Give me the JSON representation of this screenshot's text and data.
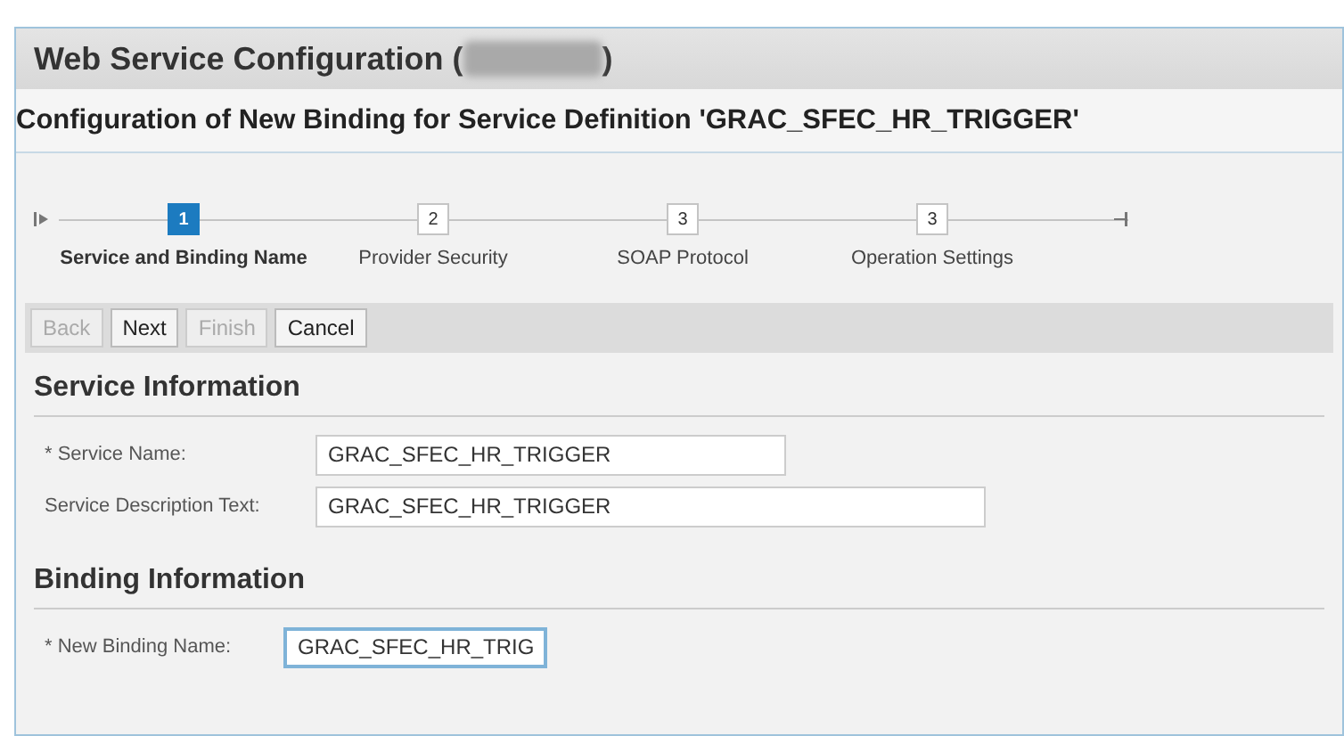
{
  "window": {
    "title_before": "Web Service Configuration (",
    "title_after": ")"
  },
  "subtitle": "Configuration of New Binding for Service Definition 'GRAC_SFEC_HR_TRIGGER'",
  "steps": [
    {
      "number": "1",
      "label": "Service and Binding Name",
      "selected": true
    },
    {
      "number": "2",
      "label": "Provider Security",
      "selected": false
    },
    {
      "number": "3",
      "label": "SOAP Protocol",
      "selected": false
    },
    {
      "number": "3",
      "label": "Operation Settings",
      "selected": false
    }
  ],
  "buttons": [
    {
      "label": "Back",
      "disabled": true
    },
    {
      "label": "Next",
      "disabled": false
    },
    {
      "label": "Finish",
      "disabled": true
    },
    {
      "label": "Cancel",
      "disabled": false
    }
  ],
  "sections": [
    {
      "title": "Service Information",
      "fields": [
        {
          "label": "* Service Name:",
          "value": "GRAC_SFEC_HR_TRIGGER",
          "focused": false
        },
        {
          "label": "Service Description Text:",
          "value": "GRAC_SFEC_HR_TRIGGER",
          "focused": false
        }
      ]
    },
    {
      "title": "Binding Information",
      "fields": [
        {
          "label": "* New Binding Name:",
          "value": "GRAC_SFEC_HR_TRIG",
          "focused": true
        }
      ]
    }
  ]
}
